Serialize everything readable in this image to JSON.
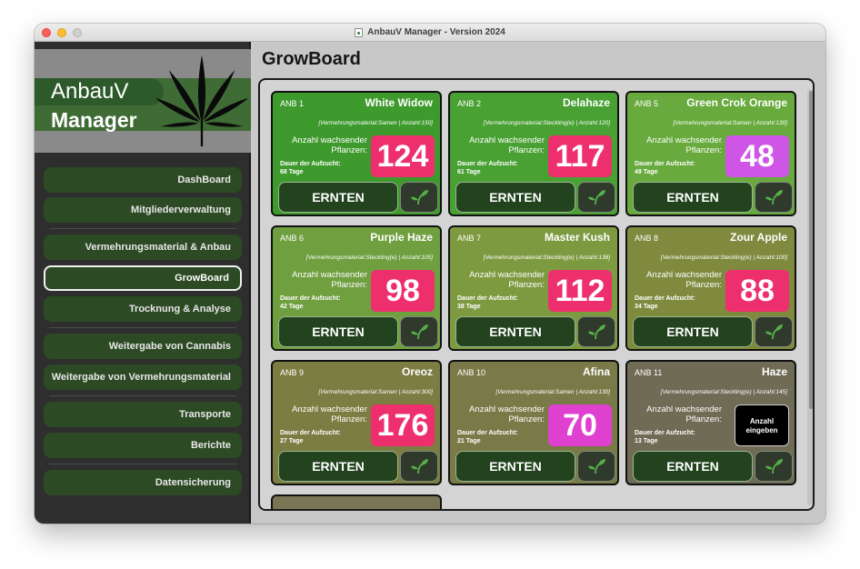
{
  "window": {
    "title": "AnbauV Manager - Version 2024"
  },
  "logo": {
    "line1": "AnbauV",
    "line2": "Manager"
  },
  "nav": {
    "items": [
      {
        "label": "DashBoard",
        "active": false
      },
      {
        "label": "Mitgliederverwaltung",
        "active": false
      },
      {
        "label": "Vermehrungsmaterial & Anbau",
        "active": false
      },
      {
        "label": "GrowBoard",
        "active": true
      },
      {
        "label": "Trocknung & Analyse",
        "active": false
      },
      {
        "label": "Weitergabe von Cannabis",
        "active": false
      },
      {
        "label": "Weitergabe von Vermehrungsmaterial",
        "active": false
      },
      {
        "label": "Transporte",
        "active": false
      },
      {
        "label": "Berichte",
        "active": false
      },
      {
        "label": "Datensicherung",
        "active": false
      }
    ]
  },
  "page": {
    "title": "GrowBoard"
  },
  "common": {
    "plants_label": "Anzahl wachsender Pflanzen:",
    "dauer_label": "Dauer der Aufzucht:",
    "ernten_label": "ERNTEN",
    "empty_count_label": "Anzahl eingeben"
  },
  "colors": {
    "count_red": "#ee2f6e",
    "count_magenta": "#e040d0",
    "count_violet": "#cf55e6"
  },
  "cards": [
    {
      "anb": "ANB 1",
      "name": "White Widow",
      "meta": "[Vermehrungsmaterial:Samen | Anzahl:150]",
      "count": "124",
      "dauer": "68 Tage",
      "bg": "#3f9a2e",
      "count_color": "#ee2f6e",
      "empty": false
    },
    {
      "anb": "ANB 2",
      "name": "Delahaze",
      "meta": "[Vermehrungsmaterial:Steckling(e) | Anzahl:120]",
      "count": "117",
      "dauer": "61 Tage",
      "bg": "#49a033",
      "count_color": "#ee2f6e",
      "empty": false
    },
    {
      "anb": "ANB 5",
      "name": "Green Crok Orange",
      "meta": "[Vermehrungsmaterial:Samen | Anzahl:130]",
      "count": "48",
      "dauer": "49 Tage",
      "bg": "#68aa3d",
      "count_color": "#cf55e6",
      "empty": false
    },
    {
      "anb": "ANB 6",
      "name": "Purple Haze",
      "meta": "[Vermehrungsmaterial:Steckling(e) | Anzahl:105]",
      "count": "98",
      "dauer": "42 Tage",
      "bg": "#6f9f3f",
      "count_color": "#ee2f6e",
      "empty": false
    },
    {
      "anb": "ANB 7",
      "name": "Master Kush",
      "meta": "[Vermehrungsmaterial:Steckling(e) | Anzahl:138]",
      "count": "112",
      "dauer": "38 Tage",
      "bg": "#7d9a40",
      "count_color": "#ee2f6e",
      "empty": false
    },
    {
      "anb": "ANB 8",
      "name": "Zour Apple",
      "meta": "[Vermehrungsmaterial:Steckling(e) | Anzahl:100]",
      "count": "88",
      "dauer": "34 Tage",
      "bg": "#7f8a3e",
      "count_color": "#ee2f6e",
      "empty": false
    },
    {
      "anb": "ANB 9",
      "name": "Oreoz",
      "meta": "[Vermehrungsmaterial:Samen | Anzahl:300]",
      "count": "176",
      "dauer": "27 Tage",
      "bg": "#7c7d42",
      "count_color": "#ee2f6e",
      "empty": false
    },
    {
      "anb": "ANB 10",
      "name": "Afina",
      "meta": "[Vermehrungsmaterial:Samen | Anzahl:130]",
      "count": "70",
      "dauer": "21 Tage",
      "bg": "#7a7a49",
      "count_color": "#e040d0",
      "empty": false
    },
    {
      "anb": "ANB 11",
      "name": "Haze",
      "meta": "[Vermehrungsmaterial:Steckling(e) | Anzahl:145]",
      "count": "",
      "dauer": "13 Tage",
      "bg": "#6f6b55",
      "count_color": "#000000",
      "empty": true
    }
  ]
}
